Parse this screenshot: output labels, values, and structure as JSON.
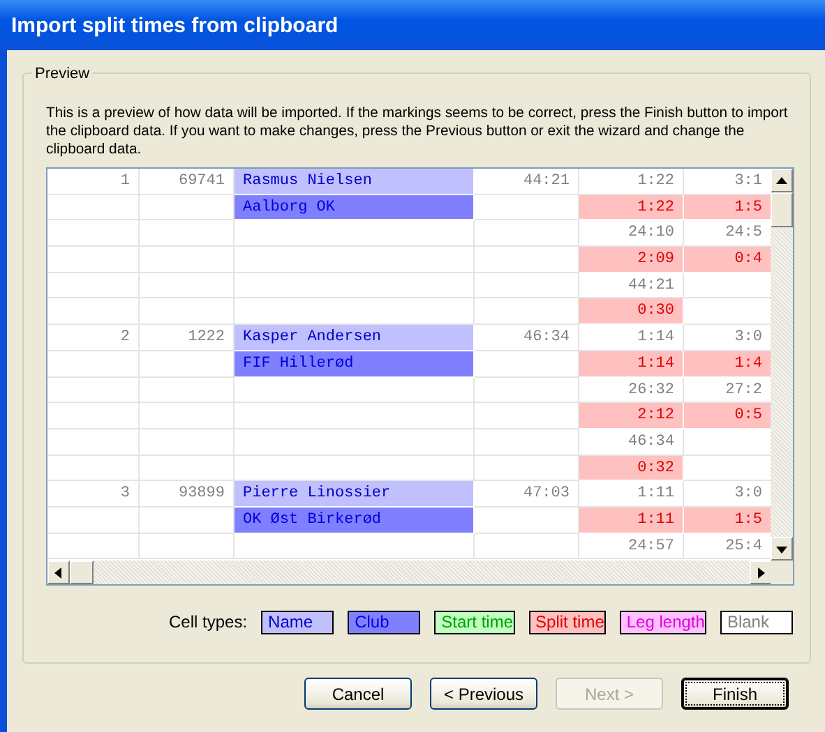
{
  "window": {
    "title": "Import split times from clipboard"
  },
  "preview": {
    "legend": "Preview",
    "description": "This is a preview of how data will be imported. If the markings seems to be correct, press the Finish button to import the clipboard data. If you want to make changes, press the Previous button or exit the wizard and change the clipboard data."
  },
  "grid": {
    "rows": [
      [
        {
          "kind": "plain",
          "text": "1"
        },
        {
          "kind": "plain",
          "text": "69741"
        },
        {
          "kind": "name",
          "text": "Rasmus Nielsen"
        },
        {
          "kind": "plain",
          "text": "44:21"
        },
        {
          "kind": "plain",
          "text": "1:22"
        },
        {
          "kind": "plain",
          "text": "3:1"
        }
      ],
      [
        {
          "kind": "blank"
        },
        {
          "kind": "blank"
        },
        {
          "kind": "club",
          "text": "Aalborg OK"
        },
        {
          "kind": "blank"
        },
        {
          "kind": "split",
          "text": "1:22"
        },
        {
          "kind": "split",
          "text": "1:5"
        }
      ],
      [
        {
          "kind": "blank"
        },
        {
          "kind": "blank"
        },
        {
          "kind": "blank"
        },
        {
          "kind": "blank"
        },
        {
          "kind": "plain",
          "text": "24:10"
        },
        {
          "kind": "plain",
          "text": "24:5"
        }
      ],
      [
        {
          "kind": "blank"
        },
        {
          "kind": "blank"
        },
        {
          "kind": "blank"
        },
        {
          "kind": "blank"
        },
        {
          "kind": "split",
          "text": "2:09"
        },
        {
          "kind": "split",
          "text": "0:4"
        }
      ],
      [
        {
          "kind": "blank"
        },
        {
          "kind": "blank"
        },
        {
          "kind": "blank"
        },
        {
          "kind": "blank"
        },
        {
          "kind": "plain",
          "text": "44:21"
        },
        {
          "kind": "blank"
        }
      ],
      [
        {
          "kind": "blank"
        },
        {
          "kind": "blank"
        },
        {
          "kind": "blank"
        },
        {
          "kind": "blank"
        },
        {
          "kind": "split",
          "text": "0:30"
        },
        {
          "kind": "blank"
        }
      ],
      [
        {
          "kind": "plain",
          "text": "2"
        },
        {
          "kind": "plain",
          "text": "1222"
        },
        {
          "kind": "name",
          "text": "Kasper Andersen"
        },
        {
          "kind": "plain",
          "text": "46:34"
        },
        {
          "kind": "plain",
          "text": "1:14"
        },
        {
          "kind": "plain",
          "text": "3:0"
        }
      ],
      [
        {
          "kind": "blank"
        },
        {
          "kind": "blank"
        },
        {
          "kind": "club",
          "text": "FIF Hillerød"
        },
        {
          "kind": "blank"
        },
        {
          "kind": "split",
          "text": "1:14"
        },
        {
          "kind": "split",
          "text": "1:4"
        }
      ],
      [
        {
          "kind": "blank"
        },
        {
          "kind": "blank"
        },
        {
          "kind": "blank"
        },
        {
          "kind": "blank"
        },
        {
          "kind": "plain",
          "text": "26:32"
        },
        {
          "kind": "plain",
          "text": "27:2"
        }
      ],
      [
        {
          "kind": "blank"
        },
        {
          "kind": "blank"
        },
        {
          "kind": "blank"
        },
        {
          "kind": "blank"
        },
        {
          "kind": "split",
          "text": "2:12"
        },
        {
          "kind": "split",
          "text": "0:5"
        }
      ],
      [
        {
          "kind": "blank"
        },
        {
          "kind": "blank"
        },
        {
          "kind": "blank"
        },
        {
          "kind": "blank"
        },
        {
          "kind": "plain",
          "text": "46:34"
        },
        {
          "kind": "blank"
        }
      ],
      [
        {
          "kind": "blank"
        },
        {
          "kind": "blank"
        },
        {
          "kind": "blank"
        },
        {
          "kind": "blank"
        },
        {
          "kind": "split",
          "text": "0:32"
        },
        {
          "kind": "blank"
        }
      ],
      [
        {
          "kind": "plain",
          "text": "3"
        },
        {
          "kind": "plain",
          "text": "93899"
        },
        {
          "kind": "name",
          "text": "Pierre Linossier"
        },
        {
          "kind": "plain",
          "text": "47:03"
        },
        {
          "kind": "plain",
          "text": "1:11"
        },
        {
          "kind": "plain",
          "text": "3:0"
        }
      ],
      [
        {
          "kind": "blank"
        },
        {
          "kind": "blank"
        },
        {
          "kind": "club",
          "text": "OK Øst Birkerød"
        },
        {
          "kind": "blank"
        },
        {
          "kind": "split",
          "text": "1:11"
        },
        {
          "kind": "split",
          "text": "1:5"
        }
      ],
      [
        {
          "kind": "blank"
        },
        {
          "kind": "blank"
        },
        {
          "kind": "blank"
        },
        {
          "kind": "blank"
        },
        {
          "kind": "plain",
          "text": "24:57"
        },
        {
          "kind": "plain",
          "text": "25:4"
        }
      ]
    ]
  },
  "cell_types": {
    "label": "Cell types:",
    "items": [
      {
        "kind": "name",
        "text": "Name"
      },
      {
        "kind": "club",
        "text": "Club"
      },
      {
        "kind": "start",
        "text": "Start time"
      },
      {
        "kind": "split",
        "text": "Split time"
      },
      {
        "kind": "leg",
        "text": "Leg length"
      },
      {
        "kind": "blank",
        "text": "Blank"
      }
    ]
  },
  "buttons": [
    {
      "text": "Cancel",
      "disabled": false,
      "default": false
    },
    {
      "text": "< Previous",
      "disabled": false,
      "default": false
    },
    {
      "text": "Next >",
      "disabled": true,
      "default": false
    },
    {
      "text": "Finish",
      "disabled": false,
      "default": true
    }
  ]
}
